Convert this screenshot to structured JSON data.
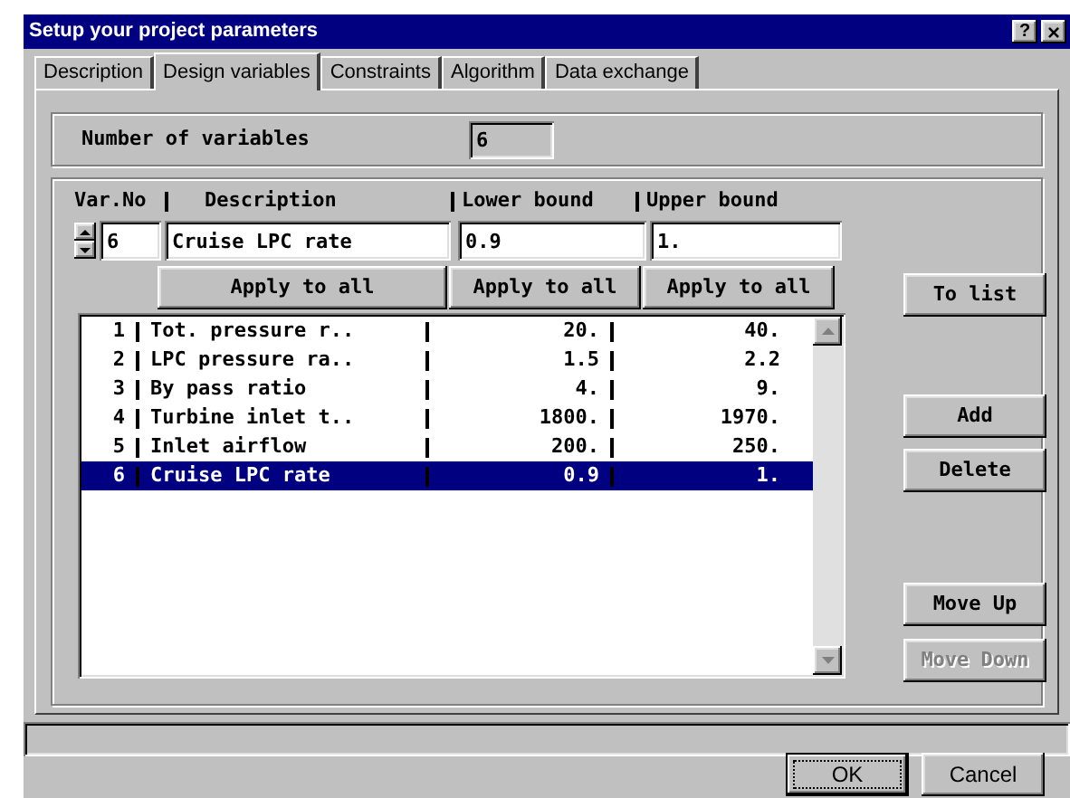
{
  "window": {
    "title": "Setup your project parameters",
    "help": "?",
    "close": "×"
  },
  "tabs": [
    {
      "label": "Description",
      "selected": false
    },
    {
      "label": "Design variables",
      "selected": true
    },
    {
      "label": "Constraints",
      "selected": false
    },
    {
      "label": "Algorithm",
      "selected": false
    },
    {
      "label": "Data exchange",
      "selected": false
    }
  ],
  "number_of_variables": {
    "label": "Number of variables",
    "value": "6"
  },
  "editor": {
    "columns": [
      "Var.No",
      "Description",
      "Lower bound",
      "Upper bound"
    ],
    "var_no": "6",
    "description": "Cruise LPC rate",
    "lower_bound": "0.9",
    "upper_bound": "1.",
    "apply_buttons": [
      "Apply to all",
      "Apply to all",
      "Apply to all"
    ]
  },
  "list": {
    "rows": [
      {
        "no": "1",
        "description": "Tot. pressure r..",
        "lower": "20.",
        "upper": "40.",
        "selected": false
      },
      {
        "no": "2",
        "description": "LPC pressure ra..",
        "lower": "1.5",
        "upper": "2.2",
        "selected": false
      },
      {
        "no": "3",
        "description": "By pass ratio",
        "lower": "4.",
        "upper": "9.",
        "selected": false
      },
      {
        "no": "4",
        "description": "Turbine inlet t..",
        "lower": "1800.",
        "upper": "1970.",
        "selected": false
      },
      {
        "no": "5",
        "description": "Inlet airflow",
        "lower": "200.",
        "upper": "250.",
        "selected": false
      },
      {
        "no": "6",
        "description": "Cruise LPC rate",
        "lower": "0.9",
        "upper": "1.",
        "selected": true
      }
    ]
  },
  "side_buttons": [
    {
      "label": "To list",
      "disabled": false
    },
    {
      "label": "Add",
      "disabled": false
    },
    {
      "label": "Delete",
      "disabled": false
    },
    {
      "label": "Move Up",
      "disabled": false
    },
    {
      "label": "Move Down",
      "disabled": true
    }
  ],
  "buttons": [
    {
      "label": "OK",
      "default": true
    },
    {
      "label": "Cancel",
      "default": false
    }
  ]
}
